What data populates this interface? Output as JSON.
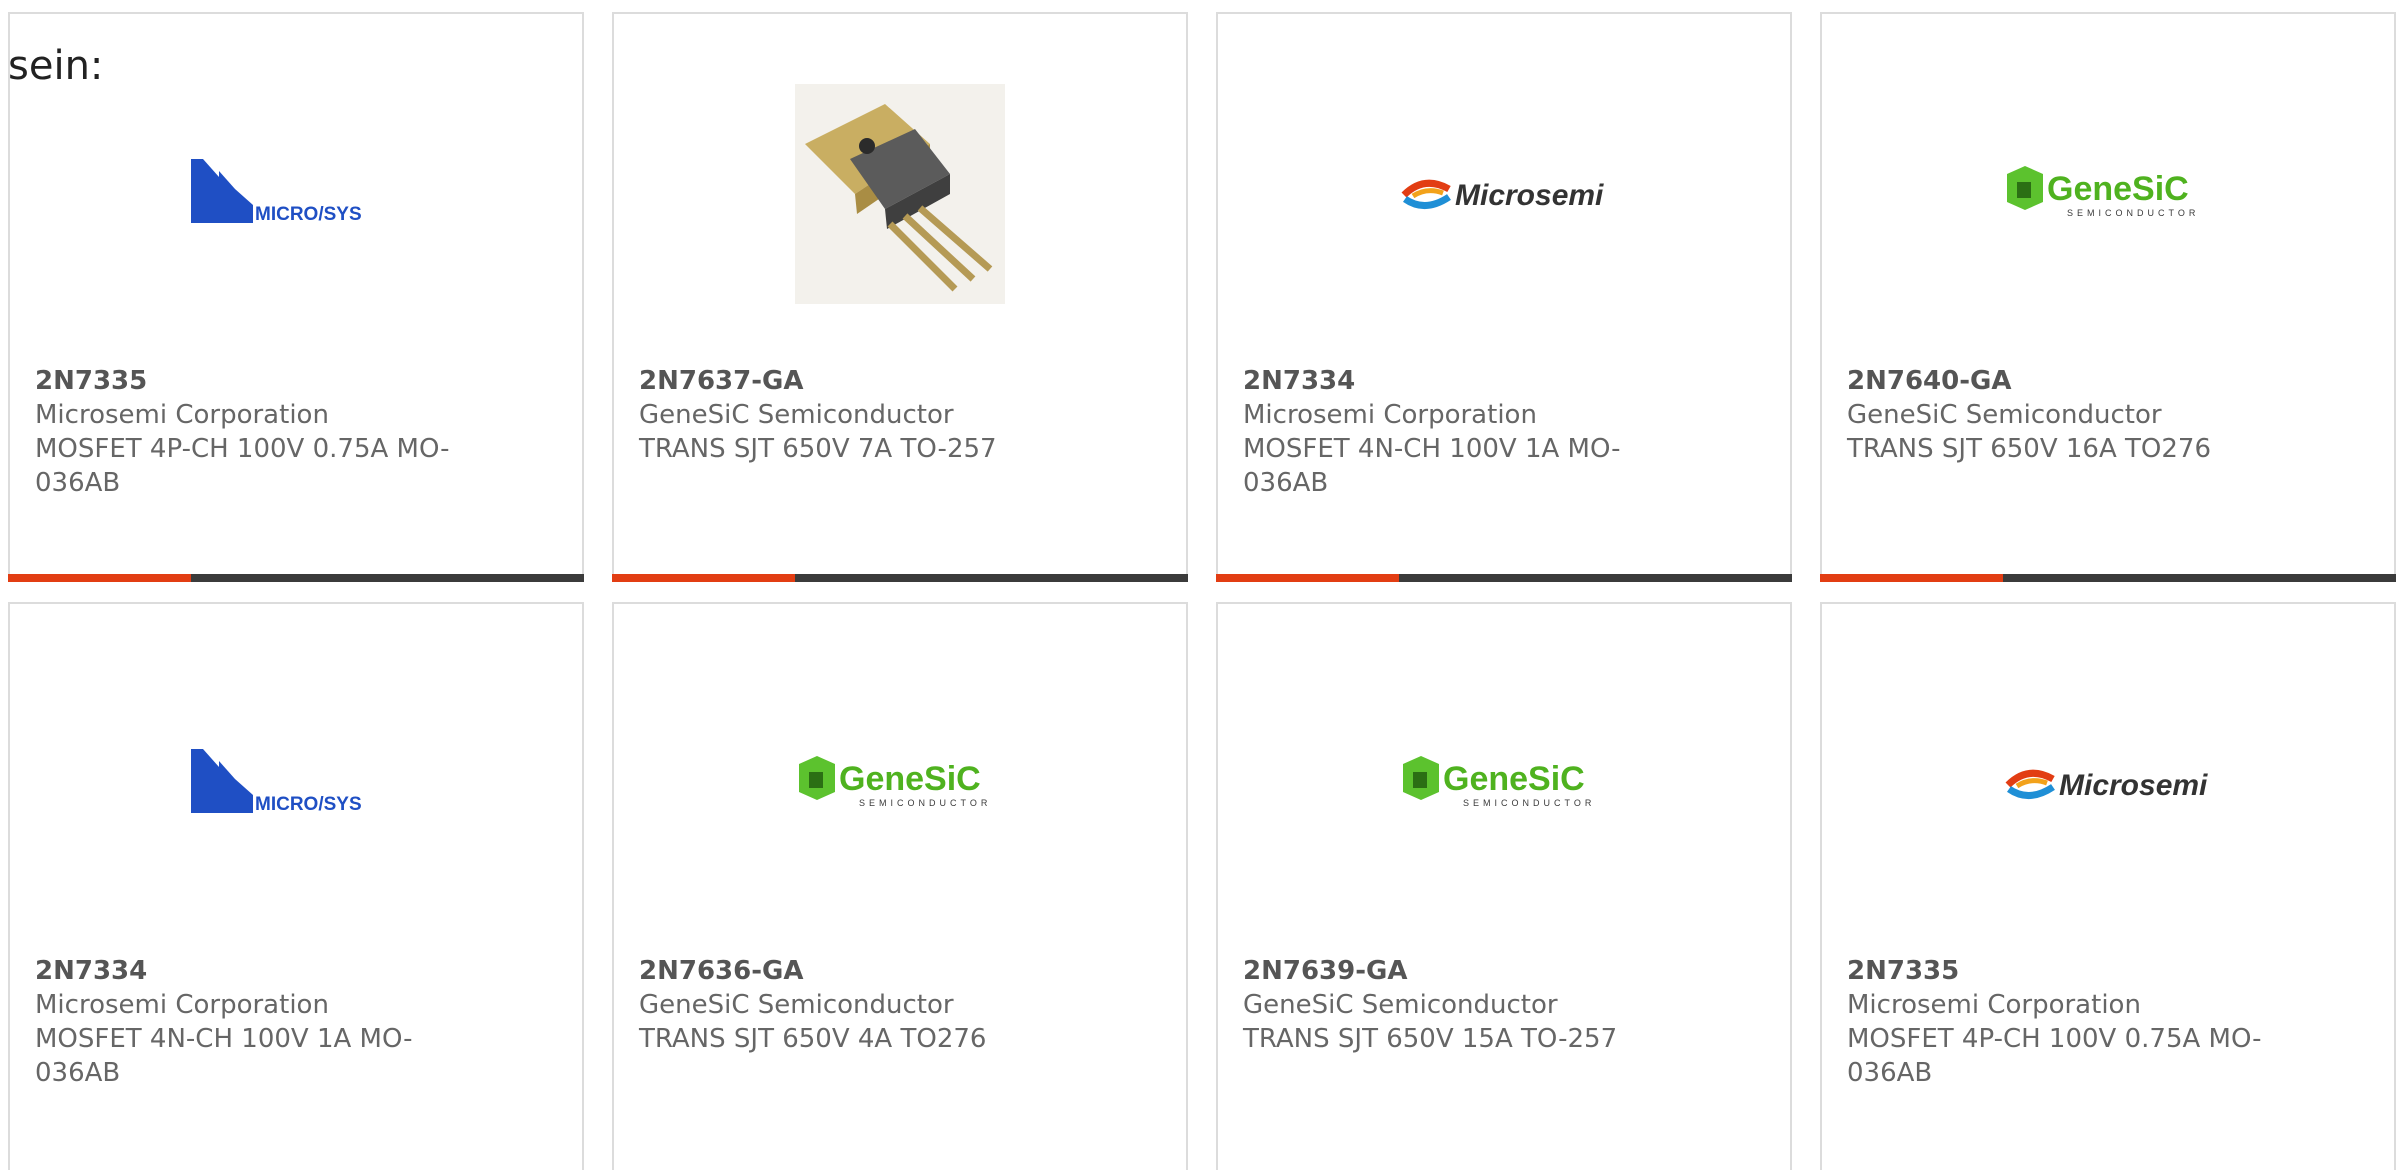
{
  "intro_text": "sein:",
  "accent_color": "#e23d13",
  "bar_color": "#3b3b3b",
  "logo_text": {
    "microsys": "MICRO/SYS",
    "microsemi": "Microsemi",
    "genesic": "GeneSiC",
    "genesic_sub": "SEMICONDUCTOR"
  },
  "cards": [
    {
      "part": "2N7335",
      "manufacturer": "Microsemi Corporation",
      "desc": "MOSFET 4P-CH 100V 0.75A MO-036AB",
      "logo": "microsys-logo"
    },
    {
      "part": "2N7637-GA",
      "manufacturer": "GeneSiC Semiconductor",
      "desc": "TRANS SJT 650V 7A TO-257",
      "logo": "to-257-package-image"
    },
    {
      "part": "2N7334",
      "manufacturer": "Microsemi Corporation",
      "desc": "MOSFET 4N-CH 100V 1A MO-036AB",
      "logo": "microsemi-logo"
    },
    {
      "part": "2N7640-GA",
      "manufacturer": "GeneSiC Semiconductor",
      "desc": "TRANS SJT 650V 16A TO276",
      "logo": "genesic-logo"
    },
    {
      "part": "2N7334",
      "manufacturer": "Microsemi Corporation",
      "desc": "MOSFET 4N-CH 100V 1A MO-036AB",
      "logo": "microsys-logo"
    },
    {
      "part": "2N7636-GA",
      "manufacturer": "GeneSiC Semiconductor",
      "desc": "TRANS SJT 650V 4A TO276",
      "logo": "genesic-logo"
    },
    {
      "part": "2N7639-GA",
      "manufacturer": "GeneSiC Semiconductor",
      "desc": "TRANS SJT 650V 15A TO-257",
      "logo": "genesic-logo"
    },
    {
      "part": "2N7335",
      "manufacturer": "Microsemi Corporation",
      "desc": "MOSFET 4P-CH 100V 0.75A MO-036AB",
      "logo": "microsemi-logo"
    }
  ]
}
